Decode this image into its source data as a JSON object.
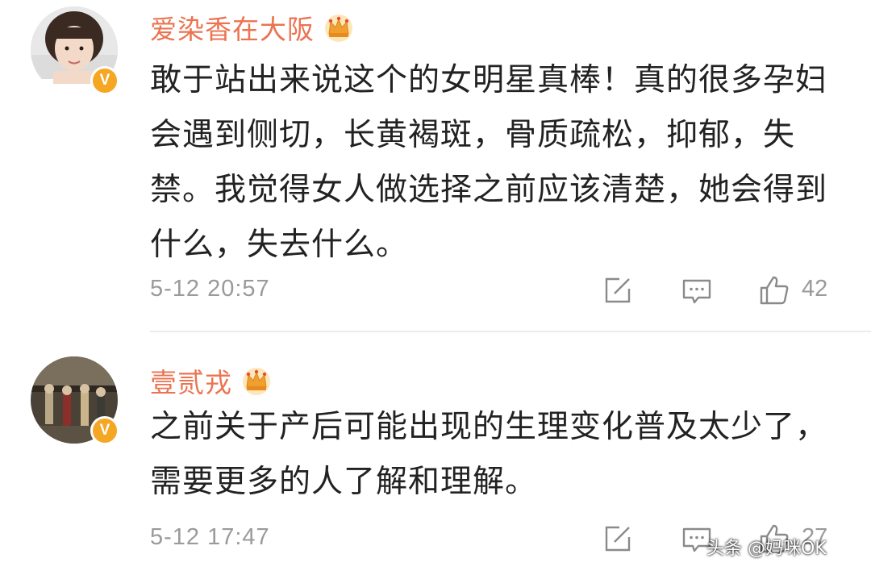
{
  "comments": [
    {
      "username": "爱染香在大阪",
      "verified_badge": "V",
      "content": "敢于站出来说这个的女明星真棒！真的很多孕妇会遇到侧切，长黄褐斑，骨质疏松，抑郁，失禁。我觉得女人做选择之前应该清楚，她会得到什么，失去什么。",
      "time": "5-12 20:57",
      "likes": "42"
    },
    {
      "username": "壹贰戎",
      "verified_badge": "V",
      "content": "之前关于产后可能出现的生理变化普及太少了，需要更多的人了解和理解。",
      "time": "5-12 17:47",
      "likes": "27"
    }
  ],
  "watermark": "头条 @妈咪OK",
  "colors": {
    "username": "#eb7350",
    "content": "#222222",
    "meta": "#9a9a9a",
    "badge": "#f5a623",
    "divider": "#ececec"
  },
  "icons": [
    "share-icon",
    "reply-icon",
    "like-icon",
    "crown-badge-icon"
  ]
}
